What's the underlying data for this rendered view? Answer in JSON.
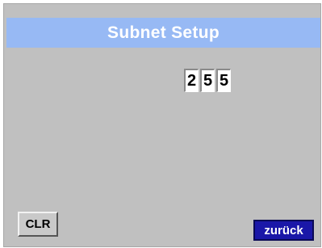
{
  "header": {
    "title": "Subnet Setup"
  },
  "subnet_octet": {
    "digits": [
      "2",
      "5",
      "5"
    ]
  },
  "buttons": {
    "clear_label": "CLR",
    "back_label": "zurück"
  },
  "colors": {
    "title_bar": "#97b9f4",
    "panel": "#c0c0c0",
    "back_button": "#1a17a8"
  }
}
